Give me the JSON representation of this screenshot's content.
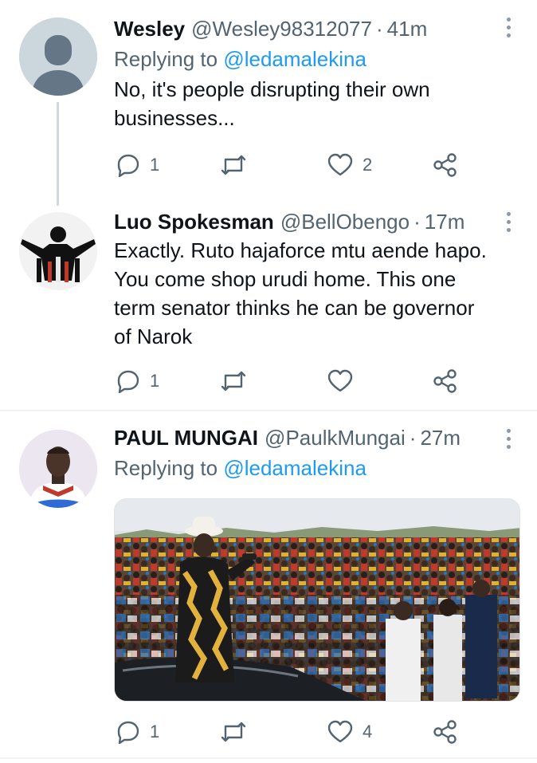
{
  "tweets": [
    {
      "name": "Wesley",
      "handle": "@Wesley98312077",
      "separator": "·",
      "time": "41m",
      "replying_prefix": "Replying to",
      "replying_to": "@ledamalekina",
      "lines": [
        "No, it's people disrupting their own",
        "businesses..."
      ],
      "replies": "1",
      "likes": "2"
    },
    {
      "name": "Luo Spokesman",
      "handle": "@BellObengo",
      "separator": "·",
      "time": "17m",
      "lines": [
        "Exactly. Ruto hajaforce mtu aende hapo.",
        "You come shop urudi home. This one",
        "term senator thinks he can be governor",
        "of Narok"
      ],
      "replies": "1",
      "likes": ""
    },
    {
      "name": "PAUL MUNGAI",
      "handle": "@PaulkMungai",
      "separator": "·",
      "time": "27m",
      "replying_prefix": "Replying to",
      "replying_to": "@ledamalekina",
      "replies": "1",
      "likes": "4"
    }
  ],
  "icons": {
    "reply": "reply-bubble-icon",
    "retweet": "retweet-arrows-icon",
    "like": "heart-icon",
    "share": "share-nodes-icon",
    "more": "vertical-dots-icon"
  },
  "colors": {
    "link": "#1d9bf0",
    "secondary_text": "#536471",
    "icon": "#536471",
    "divider": "#eff3f4",
    "thread_line": "#cfd9de"
  }
}
